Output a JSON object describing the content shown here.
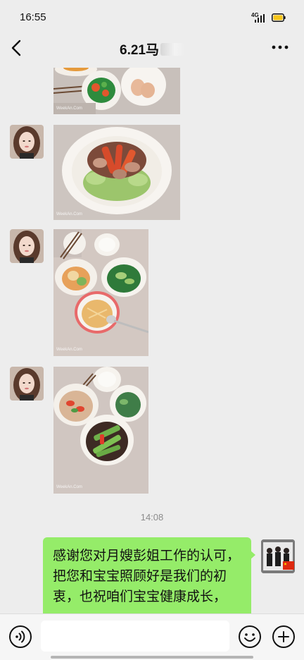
{
  "status_bar": {
    "time": "16:55",
    "network": "4G",
    "battery_color": "#f5c518"
  },
  "nav": {
    "title": "6.21马"
  },
  "messages": {
    "timestamp": "14:08",
    "photo_watermark": "WeekAn.Com",
    "text_message": "感谢您对月嫂彭姐工作的认可，把您和宝宝照顾好是我们的初衷，也祝咱们宝宝健康成长，"
  },
  "input": {
    "value": ""
  },
  "colors": {
    "bubble": "#95ec69",
    "background": "#ededed"
  }
}
